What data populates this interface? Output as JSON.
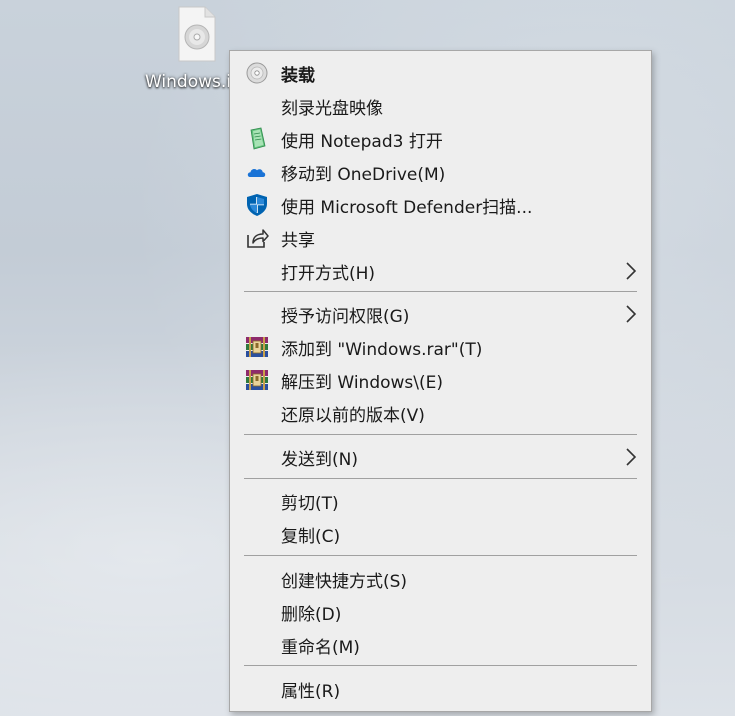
{
  "desktop": {
    "file_icon": "disc-image-file-icon",
    "file_name": "Windows.iso"
  },
  "context_menu": {
    "items": [
      {
        "label": "装载",
        "icon": "disc-icon",
        "bold": true
      },
      {
        "label": "刻录光盘映像",
        "icon": ""
      },
      {
        "label": "使用 Notepad3 打开",
        "icon": "notepad3-icon"
      },
      {
        "label": "移动到 OneDrive(M)",
        "icon": "onedrive-cloud-icon"
      },
      {
        "label": "使用 Microsoft Defender扫描...",
        "icon": "defender-shield-icon"
      },
      {
        "label": "共享",
        "icon": "share-icon"
      },
      {
        "label": "打开方式(H)",
        "icon": "",
        "submenu": true
      },
      {
        "label": "授予访问权限(G)",
        "icon": "",
        "submenu": true
      },
      {
        "label": "添加到 \"Windows.rar\"(T)",
        "icon": "winrar-icon"
      },
      {
        "label": "解压到 Windows\\(E)",
        "icon": "winrar-icon"
      },
      {
        "label": "还原以前的版本(V)",
        "icon": ""
      },
      {
        "label": "发送到(N)",
        "icon": "",
        "submenu": true
      },
      {
        "label": "剪切(T)",
        "icon": ""
      },
      {
        "label": "复制(C)",
        "icon": ""
      },
      {
        "label": "创建快捷方式(S)",
        "icon": ""
      },
      {
        "label": "删除(D)",
        "icon": ""
      },
      {
        "label": "重命名(M)",
        "icon": ""
      },
      {
        "label": "属性(R)",
        "icon": ""
      }
    ]
  },
  "colors": {
    "menu_bg": "#eeeeee",
    "separator": "#a0a0a0",
    "onedrive_blue": "#1a73d6",
    "defender_blue": "#0063b1"
  }
}
